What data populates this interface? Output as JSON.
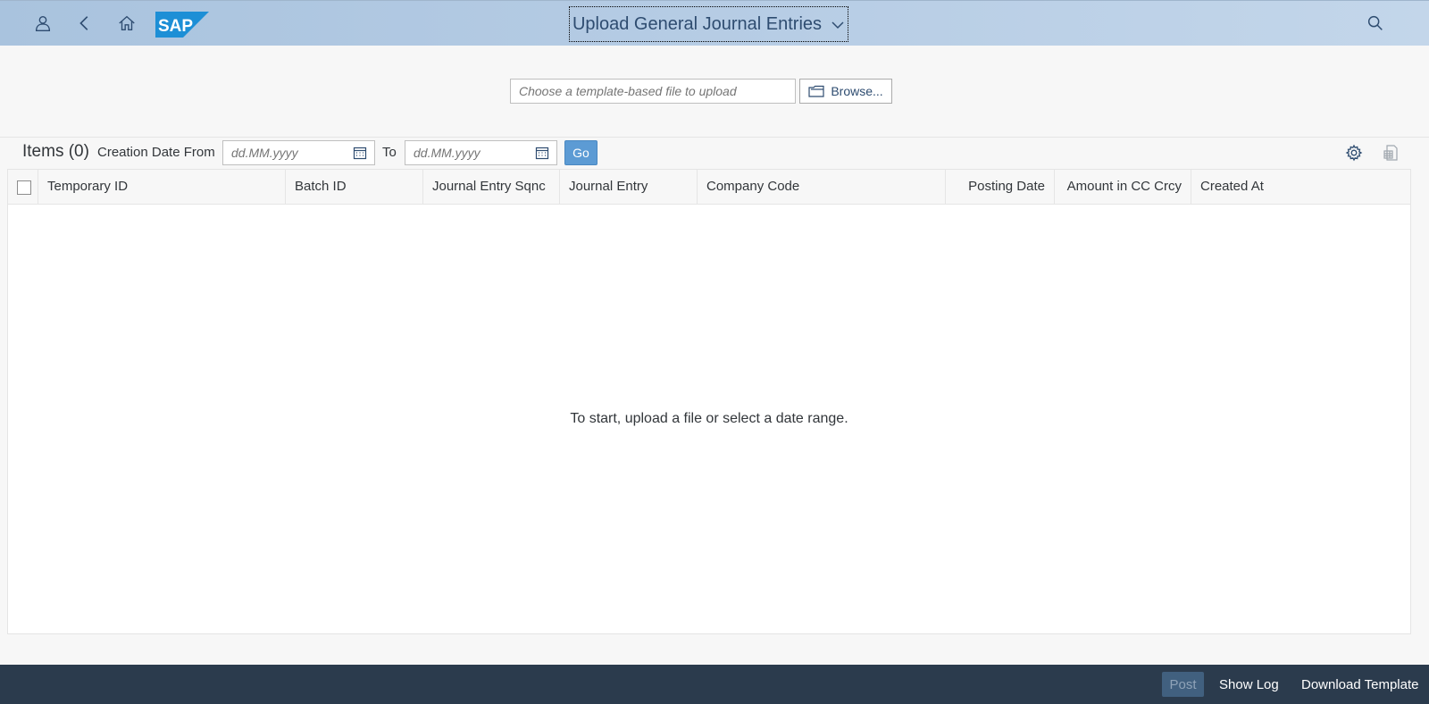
{
  "shell": {
    "app_title": "Upload General Journal Entries",
    "logo_text": "SAP"
  },
  "upload": {
    "file_placeholder": "Choose a template-based file to upload",
    "browse_label": "Browse..."
  },
  "toolbar": {
    "items_title": "Items (0)",
    "date_from_label": "Creation Date From",
    "date_to_label": "To",
    "date_placeholder": "dd.MM.yyyy",
    "go_label": "Go"
  },
  "table": {
    "columns": [
      "Temporary ID",
      "Batch ID",
      "Journal Entry Sqnc",
      "Journal Entry",
      "Company Code",
      "Posting Date",
      "Amount in CC Crcy",
      "Created At"
    ],
    "empty_message": "To start, upload a file or select a date range."
  },
  "footer": {
    "post_label": "Post",
    "show_log_label": "Show Log",
    "download_template_label": "Download Template"
  },
  "colors": {
    "shell_bg": "#b7cde5",
    "accent": "#5c9bd4",
    "footer_bg": "#2b3b4d"
  }
}
